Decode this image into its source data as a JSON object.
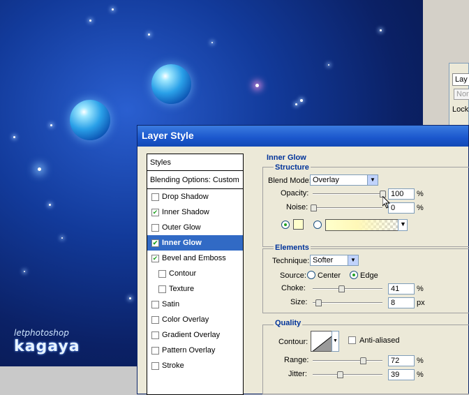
{
  "canvas": {
    "watermark_line1": "letphotoshop",
    "watermark_line2": "kagaya"
  },
  "layers_panel": {
    "tab_label": "Lay",
    "mode_label": "Norn",
    "lock_label": "Lock"
  },
  "dialog": {
    "title": "Layer Style",
    "styles_header": "Styles",
    "blending_options": "Blending Options: Custom",
    "items": [
      {
        "label": "Drop Shadow",
        "checked": false
      },
      {
        "label": "Inner Shadow",
        "checked": true
      },
      {
        "label": "Outer Glow",
        "checked": false
      },
      {
        "label": "Inner Glow",
        "checked": true,
        "selected": true
      },
      {
        "label": "Bevel and Emboss",
        "checked": true
      },
      {
        "label": "Contour",
        "checked": false
      },
      {
        "label": "Texture",
        "checked": false
      },
      {
        "label": "Satin",
        "checked": false
      },
      {
        "label": "Color Overlay",
        "checked": false
      },
      {
        "label": "Gradient Overlay",
        "checked": false
      },
      {
        "label": "Pattern Overlay",
        "checked": false
      },
      {
        "label": "Stroke",
        "checked": false
      }
    ]
  },
  "inner_glow": {
    "section_title": "Inner Glow",
    "structure": {
      "title": "Structure",
      "blend_mode_label": "Blend Mode:",
      "blend_mode_value": "Overlay",
      "opacity_label": "Opacity:",
      "opacity_value": "100",
      "opacity_unit": "%",
      "noise_label": "Noise:",
      "noise_value": "0",
      "noise_unit": "%",
      "glow_color": "#ffffcc"
    },
    "elements": {
      "title": "Elements",
      "technique_label": "Technique:",
      "technique_value": "Softer",
      "source_label": "Source:",
      "center_label": "Center",
      "edge_label": "Edge",
      "choke_label": "Choke:",
      "choke_value": "41",
      "choke_unit": "%",
      "size_label": "Size:",
      "size_value": "8",
      "size_unit": "px"
    },
    "quality": {
      "title": "Quality",
      "contour_label": "Contour:",
      "anti_aliased_label": "Anti-aliased",
      "range_label": "Range:",
      "range_value": "72",
      "range_unit": "%",
      "jitter_label": "Jitter:",
      "jitter_value": "39",
      "jitter_unit": "%"
    }
  }
}
